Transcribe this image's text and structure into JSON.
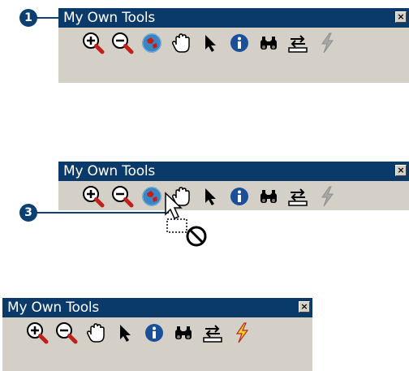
{
  "toolbars": [
    {
      "title": "My Own Tools",
      "close_label": "×",
      "tools": [
        "zoom-in",
        "zoom-out",
        "full-extent",
        "pan",
        "select",
        "identify",
        "find",
        "convert",
        "flash"
      ]
    },
    {
      "title": "My Own Tools",
      "close_label": "×",
      "tools": [
        "zoom-in",
        "zoom-out",
        "full-extent",
        "pan",
        "select",
        "identify",
        "find",
        "convert",
        "flash"
      ]
    },
    {
      "title": "My Own Tools",
      "close_label": "×",
      "tools": [
        "zoom-in",
        "zoom-out",
        "pan",
        "select",
        "identify",
        "find",
        "convert",
        "flash"
      ]
    }
  ],
  "callouts": [
    {
      "label": "1"
    },
    {
      "label": "3"
    }
  ],
  "colors": {
    "titlebar": "#0a3a6a",
    "toolbar_bg": "#d4d0c8",
    "callout": "#0d3f73"
  }
}
